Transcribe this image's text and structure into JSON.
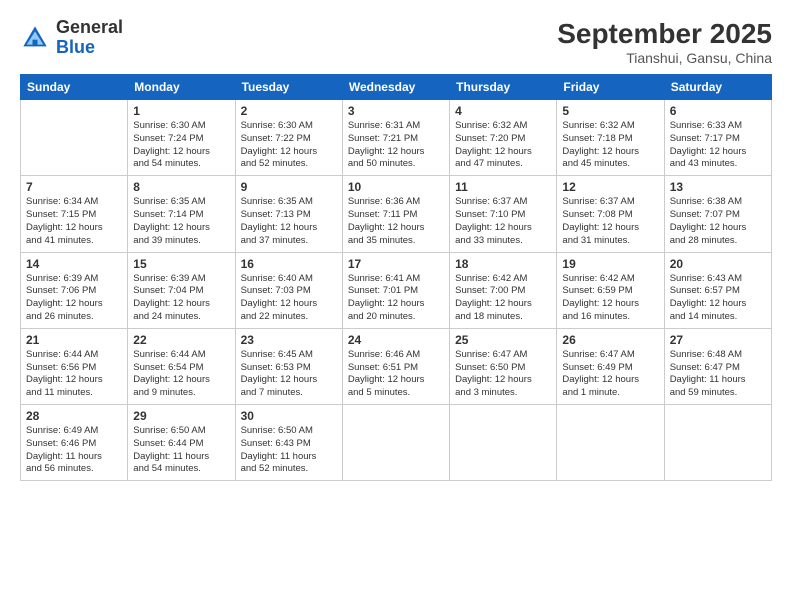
{
  "logo": {
    "general": "General",
    "blue": "Blue"
  },
  "header": {
    "month_year": "September 2025",
    "location": "Tianshui, Gansu, China"
  },
  "days_of_week": [
    "Sunday",
    "Monday",
    "Tuesday",
    "Wednesday",
    "Thursday",
    "Friday",
    "Saturday"
  ],
  "weeks": [
    [
      {
        "day": "",
        "info": ""
      },
      {
        "day": "1",
        "info": "Sunrise: 6:30 AM\nSunset: 7:24 PM\nDaylight: 12 hours\nand 54 minutes."
      },
      {
        "day": "2",
        "info": "Sunrise: 6:30 AM\nSunset: 7:22 PM\nDaylight: 12 hours\nand 52 minutes."
      },
      {
        "day": "3",
        "info": "Sunrise: 6:31 AM\nSunset: 7:21 PM\nDaylight: 12 hours\nand 50 minutes."
      },
      {
        "day": "4",
        "info": "Sunrise: 6:32 AM\nSunset: 7:20 PM\nDaylight: 12 hours\nand 47 minutes."
      },
      {
        "day": "5",
        "info": "Sunrise: 6:32 AM\nSunset: 7:18 PM\nDaylight: 12 hours\nand 45 minutes."
      },
      {
        "day": "6",
        "info": "Sunrise: 6:33 AM\nSunset: 7:17 PM\nDaylight: 12 hours\nand 43 minutes."
      }
    ],
    [
      {
        "day": "7",
        "info": "Sunrise: 6:34 AM\nSunset: 7:15 PM\nDaylight: 12 hours\nand 41 minutes."
      },
      {
        "day": "8",
        "info": "Sunrise: 6:35 AM\nSunset: 7:14 PM\nDaylight: 12 hours\nand 39 minutes."
      },
      {
        "day": "9",
        "info": "Sunrise: 6:35 AM\nSunset: 7:13 PM\nDaylight: 12 hours\nand 37 minutes."
      },
      {
        "day": "10",
        "info": "Sunrise: 6:36 AM\nSunset: 7:11 PM\nDaylight: 12 hours\nand 35 minutes."
      },
      {
        "day": "11",
        "info": "Sunrise: 6:37 AM\nSunset: 7:10 PM\nDaylight: 12 hours\nand 33 minutes."
      },
      {
        "day": "12",
        "info": "Sunrise: 6:37 AM\nSunset: 7:08 PM\nDaylight: 12 hours\nand 31 minutes."
      },
      {
        "day": "13",
        "info": "Sunrise: 6:38 AM\nSunset: 7:07 PM\nDaylight: 12 hours\nand 28 minutes."
      }
    ],
    [
      {
        "day": "14",
        "info": "Sunrise: 6:39 AM\nSunset: 7:06 PM\nDaylight: 12 hours\nand 26 minutes."
      },
      {
        "day": "15",
        "info": "Sunrise: 6:39 AM\nSunset: 7:04 PM\nDaylight: 12 hours\nand 24 minutes."
      },
      {
        "day": "16",
        "info": "Sunrise: 6:40 AM\nSunset: 7:03 PM\nDaylight: 12 hours\nand 22 minutes."
      },
      {
        "day": "17",
        "info": "Sunrise: 6:41 AM\nSunset: 7:01 PM\nDaylight: 12 hours\nand 20 minutes."
      },
      {
        "day": "18",
        "info": "Sunrise: 6:42 AM\nSunset: 7:00 PM\nDaylight: 12 hours\nand 18 minutes."
      },
      {
        "day": "19",
        "info": "Sunrise: 6:42 AM\nSunset: 6:59 PM\nDaylight: 12 hours\nand 16 minutes."
      },
      {
        "day": "20",
        "info": "Sunrise: 6:43 AM\nSunset: 6:57 PM\nDaylight: 12 hours\nand 14 minutes."
      }
    ],
    [
      {
        "day": "21",
        "info": "Sunrise: 6:44 AM\nSunset: 6:56 PM\nDaylight: 12 hours\nand 11 minutes."
      },
      {
        "day": "22",
        "info": "Sunrise: 6:44 AM\nSunset: 6:54 PM\nDaylight: 12 hours\nand 9 minutes."
      },
      {
        "day": "23",
        "info": "Sunrise: 6:45 AM\nSunset: 6:53 PM\nDaylight: 12 hours\nand 7 minutes."
      },
      {
        "day": "24",
        "info": "Sunrise: 6:46 AM\nSunset: 6:51 PM\nDaylight: 12 hours\nand 5 minutes."
      },
      {
        "day": "25",
        "info": "Sunrise: 6:47 AM\nSunset: 6:50 PM\nDaylight: 12 hours\nand 3 minutes."
      },
      {
        "day": "26",
        "info": "Sunrise: 6:47 AM\nSunset: 6:49 PM\nDaylight: 12 hours\nand 1 minute."
      },
      {
        "day": "27",
        "info": "Sunrise: 6:48 AM\nSunset: 6:47 PM\nDaylight: 11 hours\nand 59 minutes."
      }
    ],
    [
      {
        "day": "28",
        "info": "Sunrise: 6:49 AM\nSunset: 6:46 PM\nDaylight: 11 hours\nand 56 minutes."
      },
      {
        "day": "29",
        "info": "Sunrise: 6:50 AM\nSunset: 6:44 PM\nDaylight: 11 hours\nand 54 minutes."
      },
      {
        "day": "30",
        "info": "Sunrise: 6:50 AM\nSunset: 6:43 PM\nDaylight: 11 hours\nand 52 minutes."
      },
      {
        "day": "",
        "info": ""
      },
      {
        "day": "",
        "info": ""
      },
      {
        "day": "",
        "info": ""
      },
      {
        "day": "",
        "info": ""
      }
    ]
  ]
}
